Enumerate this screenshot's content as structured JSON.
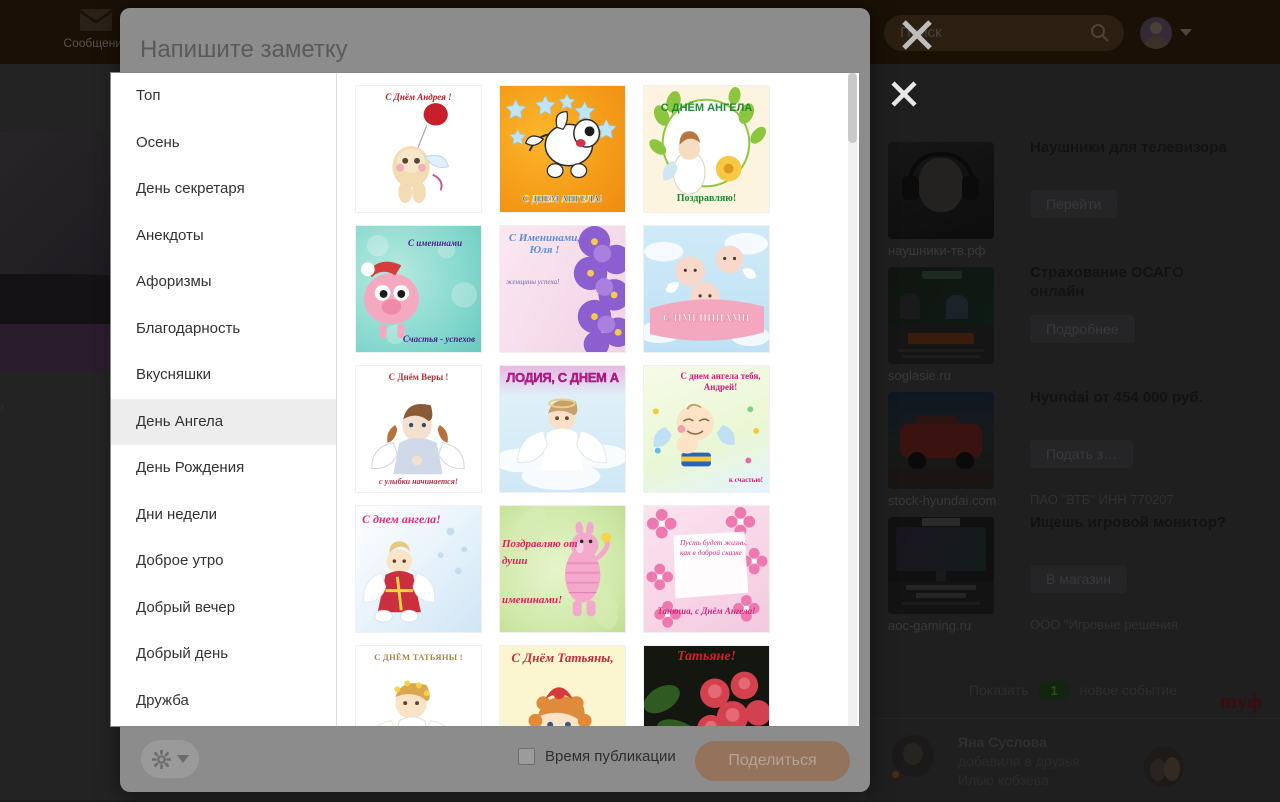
{
  "background": {
    "nav": {
      "messages_label": "Сообщения",
      "messages_icon": "envelope-icon"
    },
    "search": {
      "placeholder": "Поиск",
      "icon": "search-icon"
    },
    "avatar": {
      "name": "user-avatar"
    },
    "overlay_close_icon": "close-x-icon"
  },
  "right_panel": {
    "close_icon": "close-x-icon",
    "ads": [
      {
        "title": "Наушники для телевизора",
        "button": "Перейти",
        "domain": "наушники-тв.рф",
        "legal": "",
        "thumb": "headphones-photo"
      },
      {
        "title": "Страхование ОСАГО онлайн",
        "button": "Подробнее",
        "domain": "soglasie.ru",
        "legal": "",
        "thumb": "insurance-photo"
      },
      {
        "title": "Hyundai от 454 000 руб.",
        "button": "Подать з…",
        "domain": "stock-hyundai.com",
        "legal": "ПАО \"ВТБ\" ИНН 770207",
        "thumb": "car-photo"
      },
      {
        "title": "Ищешь игровой монитор?",
        "button": "В магазин",
        "domain": "aoc-gaming.ru",
        "legal": "ООО \"Игровые решения",
        "thumb": "monitor-photo"
      }
    ],
    "mytarget_logo": "myф",
    "events": {
      "show_label": "Показать",
      "count": "1",
      "suffix_label": "новое событие",
      "item": {
        "name": "Яна Суслова",
        "action_line1": "добавила в друзья",
        "action_line2": "Илью кобзева"
      }
    }
  },
  "modal": {
    "title": "Напишите заметку",
    "categories": [
      {
        "label": "Топ",
        "active": false
      },
      {
        "label": "Осень",
        "active": false
      },
      {
        "label": "День секретаря",
        "active": false
      },
      {
        "label": "Анекдоты",
        "active": false
      },
      {
        "label": "Афоризмы",
        "active": false
      },
      {
        "label": "Благодарность",
        "active": false
      },
      {
        "label": "Вкусняшки",
        "active": false
      },
      {
        "label": "День Ангела",
        "active": true
      },
      {
        "label": "День Рождения",
        "active": false
      },
      {
        "label": "Дни недели",
        "active": false
      },
      {
        "label": "Доброе утро",
        "active": false
      },
      {
        "label": "Добрый вечер",
        "active": false
      },
      {
        "label": "Добрый день",
        "active": false
      },
      {
        "label": "Дружба",
        "active": false
      }
    ],
    "cards": [
      {
        "id": "card-1",
        "caption_top": "С Днём Андрея !",
        "caption_bottom": ""
      },
      {
        "id": "card-2",
        "caption_top": "",
        "caption_bottom": "С ДНЕМ АНГЕЛА!"
      },
      {
        "id": "card-3",
        "caption_top": "С ДНЁМ АНГЕЛА",
        "caption_bottom": "Поздравляю!"
      },
      {
        "id": "card-4",
        "caption_top": "С именинами",
        "caption_bottom": "Счастья - успехов"
      },
      {
        "id": "card-5",
        "caption_top": "С Именинами, Юля !",
        "caption_bottom": "женщины успеха!"
      },
      {
        "id": "card-6",
        "caption_top": "",
        "caption_bottom": "С ИМЕНИНАМИ"
      },
      {
        "id": "card-7",
        "caption_top": "С Днём Веры !",
        "caption_bottom": "с улыбки начинается!"
      },
      {
        "id": "card-8",
        "caption_top": "ЛОДИЯ, С ДНЕМ А",
        "caption_bottom": ""
      },
      {
        "id": "card-9",
        "caption_top": "С днем ангела тебя, Андрей!",
        "caption_bottom": "к счастью!"
      },
      {
        "id": "card-10",
        "caption_top": "С днем ангела!",
        "caption_bottom": ""
      },
      {
        "id": "card-11",
        "caption_top": "Поздравляю от души",
        "caption_bottom": "именинами!"
      },
      {
        "id": "card-12",
        "caption_top": "Пусть будет жизнь, как в доброй сказке",
        "caption_bottom": "Танюша, с Днём Ангела!"
      },
      {
        "id": "card-13",
        "caption_top": "С ДНЁМ ТАТЬЯНЫ !",
        "caption_bottom": ""
      },
      {
        "id": "card-14",
        "caption_top": "С Днём Татьяны,",
        "caption_bottom": ""
      },
      {
        "id": "card-15",
        "caption_top": "Татьяне!",
        "caption_bottom": ""
      }
    ],
    "footer": {
      "gear_icon": "gear-icon",
      "gear_caret_icon": "caret-down-icon",
      "publish_time_label": "Время публикации",
      "share_label": "Поделиться"
    }
  },
  "colors": {
    "modal_bg": "#8c8c8c",
    "share_button": "#93735c",
    "active_category": "#ededed",
    "topbar": "#1a1006"
  }
}
